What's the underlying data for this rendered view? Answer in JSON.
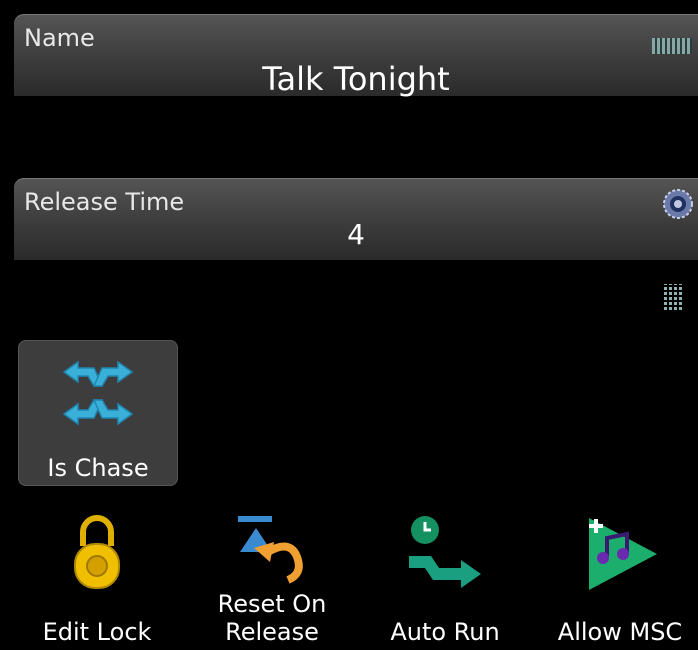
{
  "name_field": {
    "label": "Name",
    "value": "Talk Tonight",
    "icon": "keyboard-icon"
  },
  "release_field": {
    "label": "Release Time",
    "value": "4",
    "icon": "dial-icon"
  },
  "grid_icon": "keypad-icon",
  "chase_button": {
    "label": "Is Chase",
    "icon": "shuffle-arrows-icon",
    "color": "#3ab0d8"
  },
  "bottom_bar": [
    {
      "label": "Edit Lock",
      "icon": "padlock-icon",
      "color": "#e8b800"
    },
    {
      "label": "Reset On Release",
      "line1": "Reset On",
      "line2": "Release",
      "icon": "reset-arrow-icon",
      "color": "#f0a030"
    },
    {
      "label": "Auto Run",
      "icon": "auto-run-icon",
      "color": "#1a9a7a"
    },
    {
      "label": "Allow MSC",
      "icon": "msc-play-icon",
      "color": "#20b070"
    }
  ]
}
